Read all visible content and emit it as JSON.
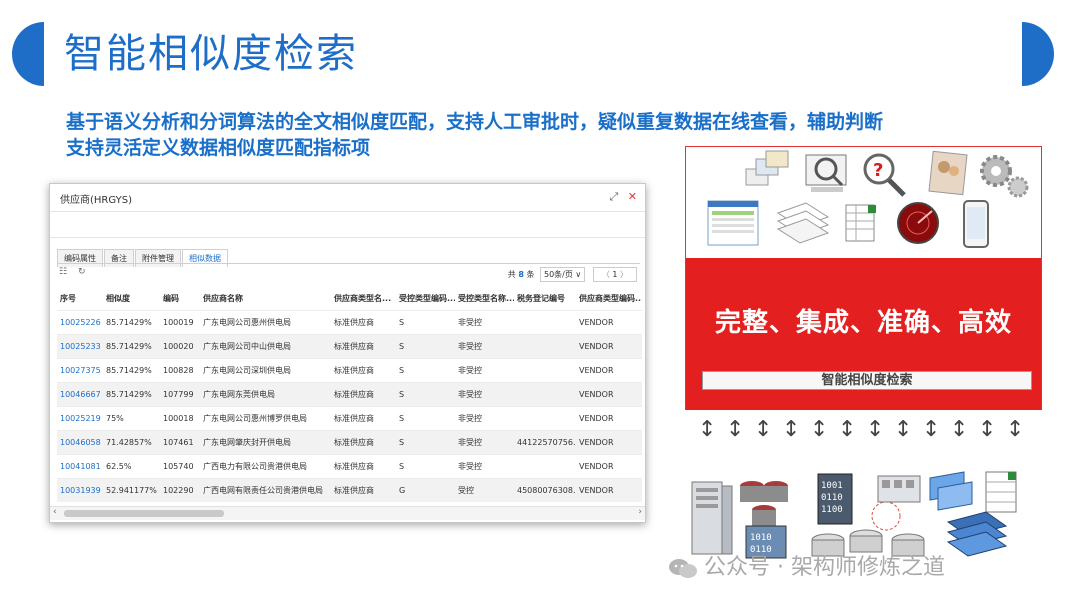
{
  "page": {
    "title": "智能相似度检索",
    "subtitle_line1": "基于语义分析和分词算法的全文相似度匹配，支持人工审批时，疑似重复数据在线查看，辅助判断",
    "subtitle_line2": "支持灵活定义数据相似度匹配指标项",
    "accent_color": "#1e6ec8"
  },
  "dialog": {
    "title": "供应商(HRGYS)",
    "expand_icon": "expand-icon",
    "close_icon": "close-icon",
    "tabs": [
      {
        "label": "编码属性"
      },
      {
        "label": "备注"
      },
      {
        "label": "附件管理"
      },
      {
        "label": "相似数据",
        "active": true
      }
    ],
    "pager": {
      "prefix": "共",
      "count": "8",
      "suffix": "条",
      "page_size": "50条/页",
      "dropdown": "∨",
      "prev": "〈",
      "page": "1",
      "next": "〉"
    },
    "columns": [
      "序号",
      "相似度",
      "编码",
      "供应商名称",
      "供应商类型名...",
      "受控类型编码...",
      "受控类型名称...",
      "税务登记编号",
      "供应商类型编码..."
    ],
    "rows": [
      [
        "10025226",
        "85.71429%",
        "100019",
        "广东电网公司惠州供电局",
        "标准供应商",
        "S",
        "非受控",
        "",
        "VENDOR"
      ],
      [
        "10025233",
        "85.71429%",
        "100020",
        "广东电网公司中山供电局",
        "标准供应商",
        "S",
        "非受控",
        "",
        "VENDOR"
      ],
      [
        "10027375",
        "85.71429%",
        "100828",
        "广东电网公司深圳供电局",
        "标准供应商",
        "S",
        "非受控",
        "",
        "VENDOR"
      ],
      [
        "10046667",
        "85.71429%",
        "107799",
        "广东电网东莞供电局",
        "标准供应商",
        "S",
        "非受控",
        "",
        "VENDOR"
      ],
      [
        "10025219",
        "75%",
        "100018",
        "广东电网公司惠州博罗供电局",
        "标准供应商",
        "S",
        "非受控",
        "",
        "VENDOR"
      ],
      [
        "10046058",
        "71.42857%",
        "107461",
        "广东电网肇庆封开供电局",
        "标准供应商",
        "S",
        "非受控",
        "44122570756...",
        "VENDOR"
      ],
      [
        "10041081",
        "62.5%",
        "105740",
        "广西电力有限公司贵港供电局",
        "标准供应商",
        "S",
        "非受控",
        "",
        "VENDOR"
      ],
      [
        "10031939",
        "52.941177%",
        "102290",
        "广西电网有限责任公司贵港供电局",
        "标准供应商",
        "G",
        "受控",
        "45080076308...",
        "VENDOR"
      ]
    ]
  },
  "panel": {
    "slogan": "完整、集成、准确、高效",
    "bar_label": "智能相似度检索",
    "panel_red": "#e41f1f",
    "top_icons": [
      "photo-stack-icon",
      "monitor-magnifier-icon",
      "question-magnifier-icon",
      "people-photo-icon",
      "gears-icon",
      "dashboard-screenshot-icon",
      "documents-stack-icon",
      "spreadsheet-icon",
      "radar-icon",
      "smartphone-icon"
    ],
    "bottom_icons": [
      "server-rack-icon",
      "database-cluster-icon",
      "data-building-icon",
      "binary-cube-icon",
      "storage-array-icon",
      "screens-icon",
      "spreadsheet-icon",
      "network-globe-icon",
      "disk-cubes-icon",
      "file-stack-icon"
    ]
  },
  "watermark": {
    "text": "公众号 · 架构师修炼之道",
    "icon": "wechat-icon"
  }
}
